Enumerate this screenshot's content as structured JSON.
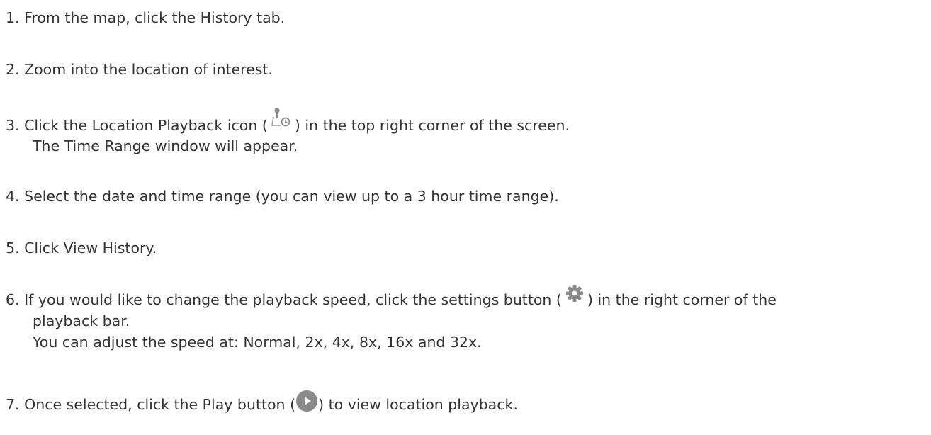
{
  "steps": [
    {
      "num": "1.",
      "text": "From the map, click the History tab."
    },
    {
      "num": "2.",
      "text": "Zoom into the location of interest."
    },
    {
      "num": "3.",
      "before": "Click the Location Playback icon (",
      "after": ") in the top right corner of the screen.",
      "line2": "The Time Range window will appear.",
      "icon": "location-playback-icon"
    },
    {
      "num": "4.",
      "text": "Select the date and time range (you can view up to a 3 hour time range)."
    },
    {
      "num": "5.",
      "text": "Click View History."
    },
    {
      "num": "6.",
      "before": "If you would like to change the playback speed, click the settings button (",
      "after": ") in the right corner of the",
      "line2": "playback bar.",
      "line3": "You can adjust the speed at: Normal, 2x, 4x, 8x, 16x and 32x.",
      "icon": "gear-icon"
    },
    {
      "num": "7.",
      "before": "Once selected, click the Play button (",
      "after": ") to view location playback.",
      "icon": "play-icon"
    }
  ],
  "colors": {
    "text": "#333333",
    "icon_gray": "#8a8a8a"
  }
}
